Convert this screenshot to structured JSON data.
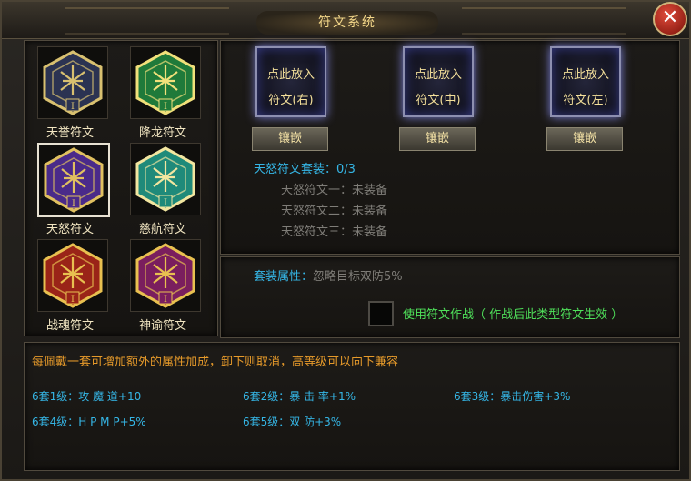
{
  "window": {
    "title": "符文系统",
    "close_icon": "✕"
  },
  "runes": [
    {
      "name": "天誉符文",
      "color": "#2b3352",
      "accent": "#d8c070",
      "numeral": "I"
    },
    {
      "name": "降龙符文",
      "color": "#1f7a3a",
      "accent": "#f1e07a",
      "numeral": "I"
    },
    {
      "name": "天怒符文",
      "color": "#4a2a8a",
      "accent": "#e0c060",
      "numeral": "I",
      "selected": true
    },
    {
      "name": "慈航符文",
      "color": "#1f8a7a",
      "accent": "#f2e6a0",
      "numeral": "I"
    },
    {
      "name": "战魂符文",
      "color": "#9a2418",
      "accent": "#e8c050",
      "numeral": "I"
    },
    {
      "name": "神谕符文",
      "color": "#7a1e5e",
      "accent": "#e8c050",
      "numeral": "I"
    }
  ],
  "sockets": [
    {
      "line1": "点此放入",
      "line2": "符文(右)",
      "button": "镶嵌"
    },
    {
      "line1": "点此放入",
      "line2": "符文(中)",
      "button": "镶嵌"
    },
    {
      "line1": "点此放入",
      "line2": "符文(左)",
      "button": "镶嵌"
    }
  ],
  "set_info": {
    "title": "天怒符文套装：0/3",
    "items": [
      "天怒符文一：未装备",
      "天怒符文二：未装备",
      "天怒符文三：未装备"
    ]
  },
  "set_bonus": {
    "label": "套装属性：",
    "value": "忽略目标双防5%",
    "checkbox_label": "使用符文作战（ 作战后此类型符文生效 ）"
  },
  "info": {
    "intro": "每佩戴一套可增加额外的属性加成，卸下则取消，高等级可以向下兼容",
    "levels": [
      "6套1级：攻 魔 道+10",
      "6套2级：暴 击 率+1%",
      "6套3级：暴击伤害+3%",
      "6套4级：H P  M P+5%",
      "6套5级：双   防+3%"
    ]
  }
}
